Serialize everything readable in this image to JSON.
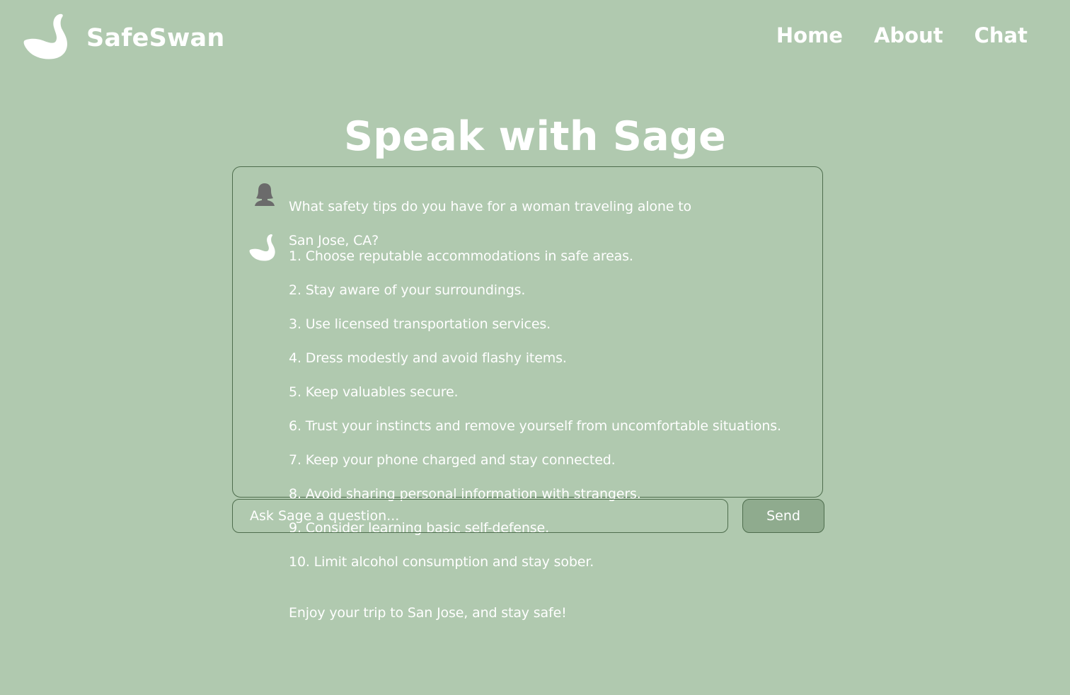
{
  "header": {
    "logo_icon": "swan-icon",
    "brand": "SafeSwan",
    "nav": [
      {
        "label": "Home"
      },
      {
        "label": "About"
      },
      {
        "label": "Chat"
      }
    ]
  },
  "main": {
    "title": "Speak with Sage"
  },
  "chat": {
    "user_message": {
      "avatar_icon": "woman-avatar-icon",
      "lines": [
        "What safety tips do you have for a woman traveling alone to",
        "San Jose, CA?"
      ]
    },
    "bot_message": {
      "avatar_icon": "swan-icon",
      "tips": [
        "1. Choose reputable accommodations in safe areas.",
        "2. Stay aware of your surroundings.",
        "3. Use licensed transportation services.",
        "4. Dress modestly and avoid flashy items.",
        "5. Keep valuables secure.",
        "6. Trust your instincts and remove yourself from uncomfortable situations.",
        "7. Keep your phone charged and stay connected.",
        "8. Avoid sharing personal information with strangers.",
        "9. Consider learning basic self-defense.",
        "10. Limit alcohol consumption and stay sober."
      ],
      "closing": "Enjoy your trip to San Jose, and stay safe!"
    }
  },
  "input": {
    "placeholder": "Ask Sage a question...",
    "value": "",
    "send_label": "Send"
  },
  "colors": {
    "background": "#b0c9af",
    "border": "#4e6d4d",
    "send_button": "#8fab8e",
    "text": "#ffffff",
    "user_avatar": "#6b6b6b"
  }
}
